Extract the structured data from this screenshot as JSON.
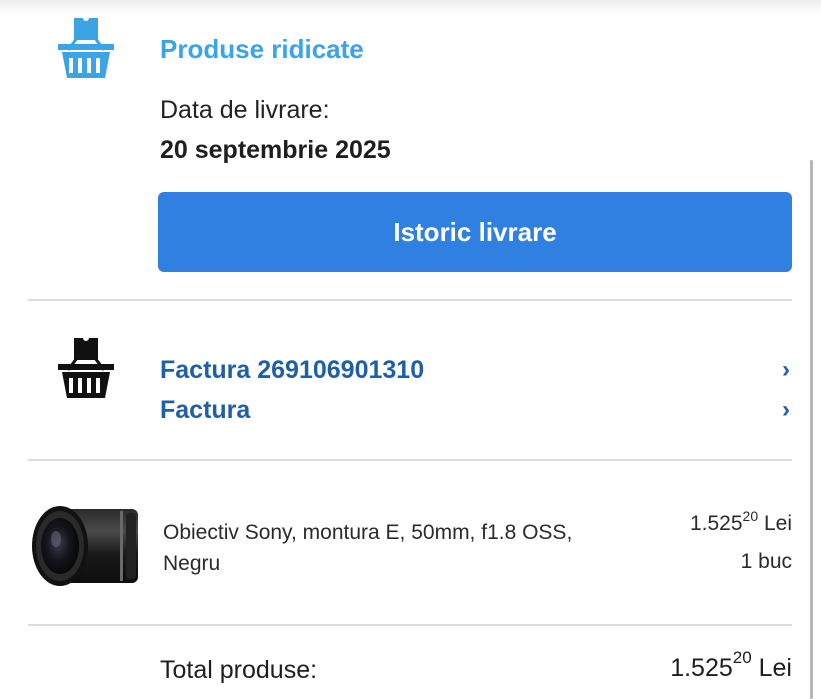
{
  "pickup": {
    "title": "Produse ridicate",
    "delivery_label": "Data de livrare:",
    "delivery_date": "20 septembrie 2025",
    "history_button": "Istoric livrare"
  },
  "invoices": [
    {
      "label": "Factura 269106901310",
      "chevron": "›"
    },
    {
      "label": "Factura",
      "chevron": "›"
    }
  ],
  "product": {
    "name": "Obiectiv Sony, montura E, 50mm, f1.8 OSS, Negru",
    "price_whole": "1.525",
    "price_decimals": "20",
    "currency": "Lei",
    "quantity": "1 buc"
  },
  "totals": {
    "label": "Total produse:",
    "value_whole": "1.525",
    "value_decimals": "20",
    "currency": "Lei"
  },
  "colors": {
    "accent_blue": "#3ba4e6",
    "button_blue": "#2f80e0",
    "link_blue": "#1f5fa8"
  },
  "icons": {
    "pickup": "shopping-basket-icon",
    "invoice": "shopping-basket-icon",
    "chevron": "chevron-right-icon"
  }
}
